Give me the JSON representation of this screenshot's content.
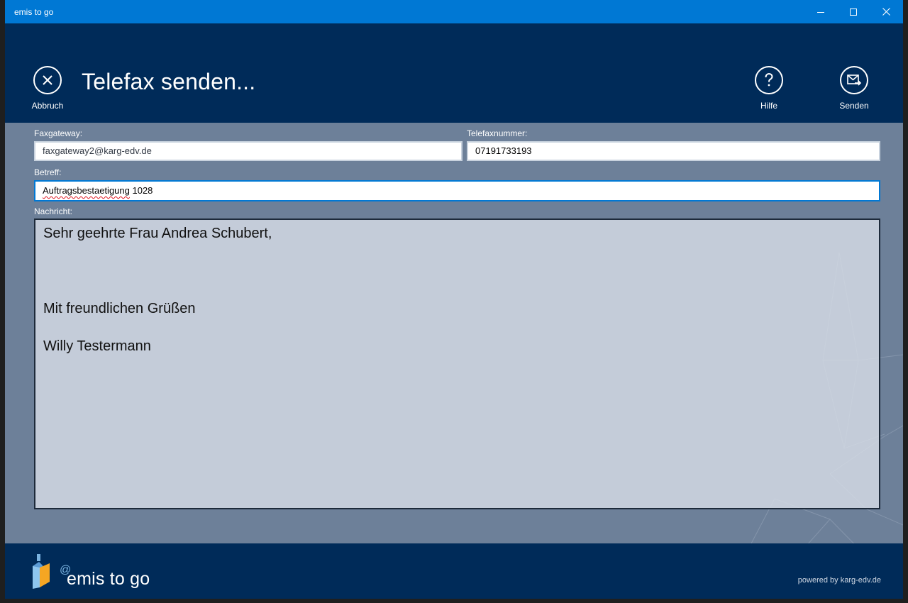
{
  "window": {
    "title": "emis to go",
    "controls": [
      "minimize-icon",
      "maximize-icon",
      "close-icon"
    ]
  },
  "header": {
    "title": "Telefax senden...",
    "cancel_label": "Abbruch",
    "help_label": "Hilfe",
    "send_label": "Senden"
  },
  "form": {
    "faxgateway_label": "Faxgateway:",
    "faxgateway_value": "faxgateway2@karg-edv.de",
    "faxnumber_label": "Telefaxnummer:",
    "faxnumber_value": "07191733193",
    "subject_label": "Betreff:",
    "subject_word_misspelled": "Auftragsbestaetigung",
    "subject_rest": " 1028",
    "message_label": "Nachricht:",
    "message_lines": [
      "Sehr geehrte Frau Andrea Schubert,",
      "",
      "",
      "",
      "Mit freundlichen Grüßen",
      "",
      "Willy Testermann"
    ]
  },
  "footer": {
    "brand_at": "@",
    "brand_name": "emis to go",
    "powered_by": "powered by karg-edv.de"
  },
  "colors": {
    "titlebar": "#0078d4",
    "header_bg": "#002b59",
    "content_bg": "#6d8099",
    "focus_border": "#0078d4"
  }
}
